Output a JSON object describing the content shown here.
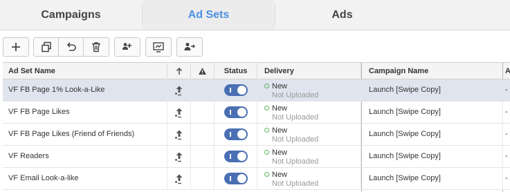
{
  "tabs": [
    {
      "label": "Campaigns"
    },
    {
      "label": "Ad Sets"
    },
    {
      "label": "Ads"
    }
  ],
  "active_tab": "Ad Sets",
  "colors": {
    "accent": "#4a90e2",
    "toggle_on": "#4a6fb3",
    "status_new": "#5cb85c",
    "selected_row": "#dfe4ee"
  },
  "toolbar": {
    "icons": [
      "plus-icon",
      "duplicate-icon",
      "undo-icon",
      "trash-icon",
      "add-audience-icon",
      "export-icon",
      "assign-user-icon"
    ]
  },
  "table": {
    "headers": {
      "name": "Ad Set Name",
      "status": "Status",
      "delivery": "Delivery",
      "campaign": "Campaign Name",
      "extra": "A"
    },
    "rows": [
      {
        "name": "VF FB Page 1% Look-a-Like",
        "status_on": true,
        "delivery": "New",
        "upload": "Not Uploaded",
        "campaign": "Launch [Swipe Copy]",
        "extra": "-",
        "selected": true
      },
      {
        "name": "VF FB Page Likes",
        "status_on": true,
        "delivery": "New",
        "upload": "Not Uploaded",
        "campaign": "Launch [Swipe Copy]",
        "extra": "-",
        "selected": false
      },
      {
        "name": "VF FB Page Likes (Friend of Friends)",
        "status_on": true,
        "delivery": "New",
        "upload": "Not Uploaded",
        "campaign": "Launch [Swipe Copy]",
        "extra": "-",
        "selected": false
      },
      {
        "name": "VF Readers",
        "status_on": true,
        "delivery": "New",
        "upload": "Not Uploaded",
        "campaign": "Launch [Swipe Copy]",
        "extra": "-",
        "selected": false
      },
      {
        "name": "VF Email Look-a-like",
        "status_on": true,
        "delivery": "New",
        "upload": "Not Uploaded",
        "campaign": "Launch [Swipe Copy]",
        "extra": "-",
        "selected": false
      }
    ]
  }
}
